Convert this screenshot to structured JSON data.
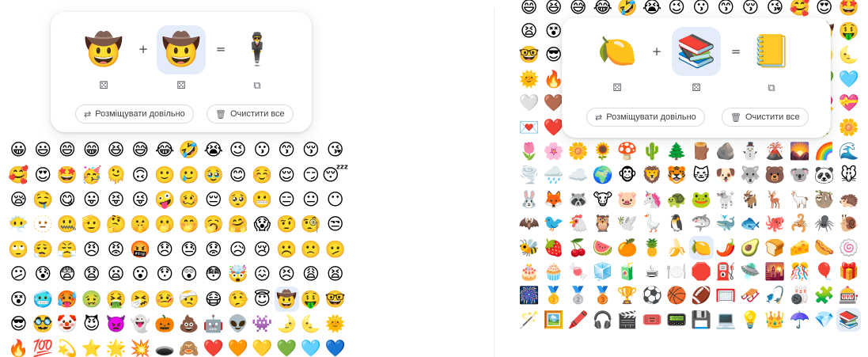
{
  "left_panel": {
    "kitchen": {
      "first_emoji": "🤠",
      "second_emoji": "🤠",
      "result_emoji": "🕴️",
      "plus": "+",
      "equals": "=",
      "dice_icon": "⚄",
      "copy_icon": "⧉",
      "random_button": {
        "label": "Розміщувати довільно",
        "icon": "shuffle-icon"
      },
      "clear_button": {
        "label": "Очистити все",
        "icon": "trash-icon"
      }
    },
    "emoji_rows": [
      [
        "😀",
        "😃",
        "😄",
        "😁",
        "😆",
        "😅",
        "😂",
        "🤣",
        "😭",
        "😉",
        "😗",
        "😙",
        "😚",
        "😘"
      ],
      [
        "🥰",
        "😍",
        "🤩",
        "🥳",
        "🫠",
        "🙃",
        "🙂",
        "🥲",
        "🥹",
        "😊",
        "☺️",
        "😌",
        "😏",
        "😴"
      ],
      [
        "😪",
        "🤤",
        "😋",
        "😛",
        "😝",
        "😜",
        "🤪",
        "🥴",
        "😔",
        "🥺",
        "😬",
        "😑",
        "😐",
        "😶"
      ],
      [
        "😶‍🌫️",
        "🫥",
        "🤐",
        "🫡",
        "🤔",
        "🤫",
        "🫢",
        "🤭",
        "🥱",
        "🤗",
        "😱",
        "🤨",
        "🧐",
        "😒"
      ],
      [
        "🙄",
        "😮‍💨",
        "😤",
        "😠",
        "😡",
        "🤬",
        "😞",
        "😓",
        "😟",
        "😥",
        "😢",
        "☹️",
        "🙁",
        "🫤"
      ],
      [
        "😕",
        "😰",
        "😨",
        "😧",
        "😦",
        "😮",
        "😯",
        "😲",
        "😳",
        "🤯",
        "😖",
        "😣",
        "😩",
        "😫"
      ],
      [
        "😵",
        "🥶",
        "🥵",
        "🤢",
        "🤮",
        "🤧",
        "🤒",
        "🤕",
        "😷",
        "🤥",
        "😇",
        "🤠",
        "🤑",
        "🤓"
      ],
      [
        "😎",
        "🥸",
        "🤡",
        "😈",
        "👿",
        "👻",
        "🎃",
        "💩",
        "🤖",
        "👽",
        "👾",
        "🌛",
        "🌜",
        "🌞"
      ],
      [
        "🔥",
        "💯",
        "💫",
        "⭐",
        "🌟",
        "💥",
        "🕳️",
        "🙈",
        "❤️",
        "🧡",
        "💛",
        "💚",
        "🩵",
        "💙"
      ]
    ]
  },
  "right_panel": {
    "kitchen": {
      "first_emoji": "🍋",
      "second_emoji": "📚",
      "result_emoji": "📒",
      "plus": "+",
      "equals": "=",
      "dice_icon": "⚄",
      "copy_icon": "⧉",
      "random_button": {
        "label": "Розміщувати довільно",
        "icon": "shuffle-icon"
      },
      "clear_button": {
        "label": "Очистити все",
        "icon": "trash-icon"
      }
    },
    "emoji_rows": [
      [
        "😄",
        "😆",
        "😅",
        "😂",
        "🤣",
        "😭",
        "😉",
        "😗",
        "😙",
        "😚",
        "😘",
        "🥰",
        "😍",
        "🤩"
      ],
      [
        "😫",
        "😵",
        "🥶",
        "🥵",
        "🤢",
        "🤮",
        "🤧",
        "🤒",
        "🤕",
        "😷",
        "🤥",
        "😇",
        "🤠",
        "🤑"
      ],
      [
        "🤓",
        "😎",
        "🥸",
        "🤡",
        "😈",
        "👿",
        "👻",
        "🎃",
        "💩",
        "🤖",
        "👽",
        "👾",
        "🌛",
        "🌜"
      ],
      [
        "🌞",
        "🔥",
        "💯",
        "💫",
        "⭐",
        "🌟",
        "💥",
        "🕳️",
        "🙈",
        "❤️",
        "🧡",
        "💛",
        "💚",
        "🩵"
      ],
      [
        "🤍",
        "🤎",
        "🖤",
        "🩶",
        "💔",
        "❤️‍🔥",
        "❤️‍🩹",
        "💕",
        "💞",
        "💓",
        "💗",
        "💖",
        "💘",
        "💝"
      ],
      [
        "💌",
        "❤️",
        "💋",
        "🫦",
        "🎀",
        "🌹",
        "🥀",
        "🌺",
        "🌷",
        "🪷",
        "🌸",
        "💐",
        "🌻",
        "🌼"
      ],
      [
        "🌷",
        "🌸",
        "🌼",
        "🌻",
        "🍄",
        "🌵",
        "🌲",
        "🪵",
        "🪨",
        "⛄",
        "🌋",
        "🌄",
        "🌈",
        "🌊"
      ],
      [
        "🌪️",
        "🌧️",
        "☁️",
        "🌍",
        "🐵",
        "🦁",
        "🐯",
        "🐱",
        "🐶",
        "🐺",
        "🐻",
        "🐨",
        "🐼",
        "🐭"
      ],
      [
        "🐰",
        "🦊",
        "🦝",
        "🐮",
        "🐷",
        "🦄",
        "🐢",
        "🐸",
        "🐩",
        "🐐",
        "🦌",
        "🦙",
        "🦥",
        "🦔"
      ],
      [
        "🦇",
        "🐦",
        "🐔",
        "🦉",
        "🕊️",
        "🪿",
        "🐧",
        "🦈",
        "🐳",
        "🐟",
        "🐙",
        "🦂",
        "🕷️",
        "🐌"
      ],
      [
        "🐝",
        "🍓",
        "🍒",
        "🍉",
        "🍊",
        "🍍",
        "🍌",
        "🍋",
        "🌶️",
        "🥑",
        "🍞",
        "🧀",
        "🌭",
        "🍥"
      ],
      [
        "🎂",
        "🧁",
        "🍬",
        "🧊",
        "🧃",
        "☕",
        "🍽️",
        "🛑",
        "⛽",
        "🛸",
        "🌇",
        "🎊",
        "🎈",
        "🎁"
      ],
      [
        "🎆",
        "🥇",
        "🥈",
        "🥉",
        "🏆",
        "⚽",
        "🏀",
        "🏈",
        "🥅",
        "🛷",
        "🎣",
        "🎳",
        "🧩",
        "🎰"
      ],
      [
        "🪄",
        "🖼️",
        "🖍️",
        "🎧",
        "🎬",
        "🎟️",
        "📟",
        "💾",
        "💻",
        "💡",
        "👑",
        "☂️",
        "💎",
        "📚"
      ]
    ]
  }
}
